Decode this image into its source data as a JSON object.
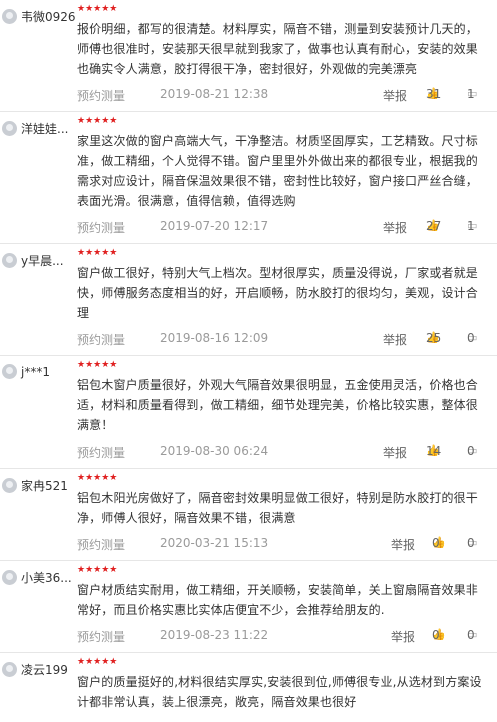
{
  "stars": "★★★★★",
  "icons": {
    "like": "thumbs-up-icon",
    "comment": "comment-icon"
  },
  "reviews": [
    {
      "user": "韦微0926",
      "content": "报价明细，都写的很清楚。材料厚实，隔音不错，测量到安装预计几天的，师傅也很准时，安装那天很早就到我家了，做事也认真有耐心，安装的效果也确实令人满意，胶打得很干净，密封很好，外观做的完美漂亮",
      "tag": "预约测量",
      "date": "2019-08-21 12:38",
      "report": "举报",
      "likes": "31",
      "comments": "1"
    },
    {
      "user": "洋娃娃...",
      "content": "家里这次做的窗户高端大气，干净整洁。材质坚固厚实，工艺精致。尺寸标准，做工精细，个人觉得不错。窗户里里外外做出来的都很专业，根据我的需求对应设计，隔音保温效果很不错，密封性比较好，窗户接口严丝合缝，表面光滑。很满意，值得信赖，值得选购",
      "tag": "预约测量",
      "date": "2019-07-20 12:17",
      "report": "举报",
      "likes": "27",
      "comments": "1"
    },
    {
      "user": "y早晨...",
      "content": "窗户做工很好，特别大气上档次。型材很厚实，质量没得说，厂家或者就是快，师傅服务态度相当的好，开启顺畅，防水胶打的很均匀，美观，设计合理",
      "tag": "预约测量",
      "date": "2019-08-16 12:09",
      "report": "举报",
      "likes": "25",
      "comments": "0"
    },
    {
      "user": "j***1",
      "content": "铝包木窗户质量很好，外观大气隔音效果很明显，五金使用灵活，价格也合适，材料和质量看得到，做工精细，细节处理完美，价格比较实惠，整体很满意！",
      "tag": "预约测量",
      "date": "2019-08-30 06:24",
      "report": "举报",
      "likes": "14",
      "comments": "0"
    },
    {
      "user": "家冉521",
      "content": "铝包木阳光房做好了，隔音密封效果明显做工很好，特别是防水胶打的很干净，师傅人很好，隔音效果不错，很满意",
      "tag": "预约测量",
      "date": "2020-03-21 15:13",
      "report": "举报",
      "likes": "0",
      "comments": "0"
    },
    {
      "user": "小美36...",
      "content": "窗户材质结实耐用，做工精细，开关顺畅，安装简单，关上窗扇隔音效果非常好，而且价格实惠比实体店便宜不少，会推荐给朋友的.",
      "tag": "预约测量",
      "date": "2019-08-23 11:22",
      "report": "举报",
      "likes": "0",
      "comments": "0"
    },
    {
      "user": "凌云199",
      "content": "窗户的质量挺好的,材料很结实厚实,安装很到位,师傅很专业,从选材到方案设计都非常认真，装上很漂亮，敞亮，隔音效果也很好",
      "tag": "",
      "date": "",
      "report": "",
      "likes": "",
      "comments": ""
    }
  ]
}
